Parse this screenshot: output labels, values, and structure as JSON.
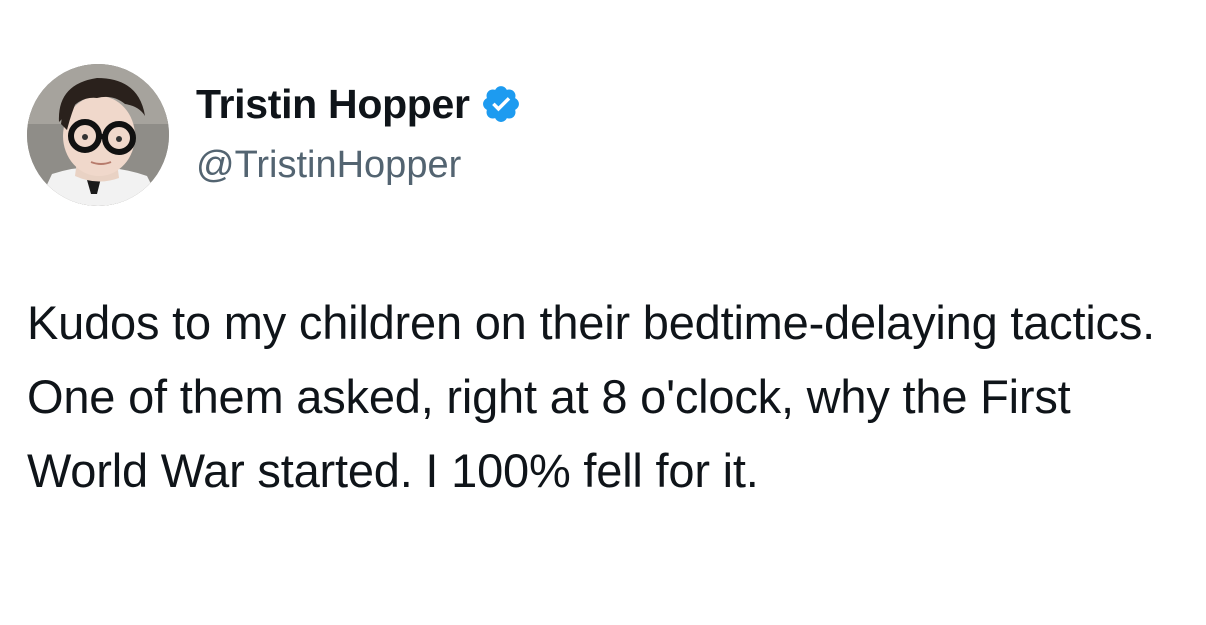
{
  "author": {
    "display_name": "Tristin Hopper",
    "handle": "@TristinHopper",
    "verified": true,
    "avatar_icon": "profile-photo-avatar"
  },
  "tweet": {
    "text": "Kudos to my children on their bedtime-delaying tactics. One of them asked, right at 8 o'clock, why the First World War started. I 100% fell for it."
  },
  "colors": {
    "text": "#0f1419",
    "handle": "#536471",
    "verified_badge": "#1d9bf0",
    "background": "#ffffff"
  }
}
